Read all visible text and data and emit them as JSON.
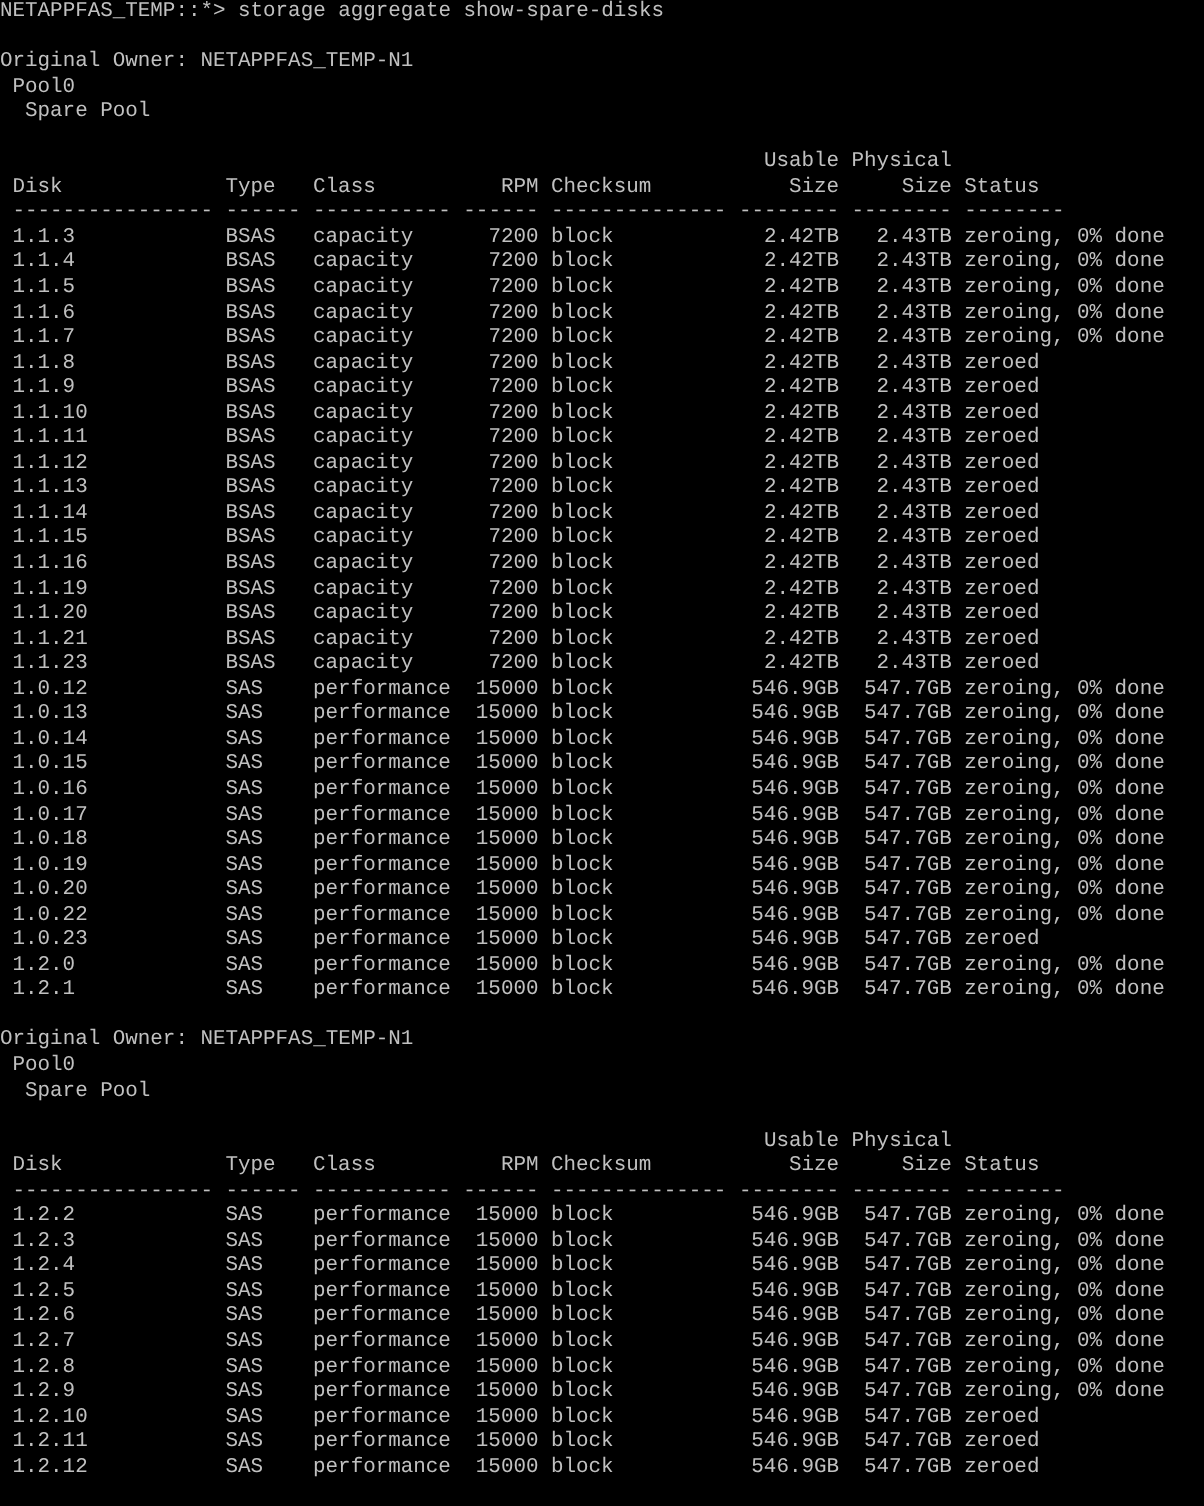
{
  "prompt": "NETAPPFAS_TEMP::*> storage aggregate show-spare-disks",
  "sections": [
    {
      "owner": "Original Owner: NETAPPFAS_TEMP-N1",
      "pool": "Pool0",
      "spare_pool": "Spare Pool",
      "columns": [
        {
          "label": "Disk"
        },
        {
          "label": "Type"
        },
        {
          "label": "Class"
        },
        {
          "label": "RPM"
        },
        {
          "label": "Checksum"
        },
        {
          "label_above": "Usable",
          "label": "Size"
        },
        {
          "label_above": "Physical",
          "label": "Size"
        },
        {
          "label": "Status"
        }
      ],
      "separators": [
        "----------------",
        "------",
        "-----------",
        "------",
        "--------------",
        "--------",
        "--------",
        "--------"
      ],
      "rows": [
        [
          "1.1.3",
          "BSAS",
          "capacity",
          "7200",
          "block",
          "2.42TB",
          "2.43TB",
          "zeroing, 0% done"
        ],
        [
          "1.1.4",
          "BSAS",
          "capacity",
          "7200",
          "block",
          "2.42TB",
          "2.43TB",
          "zeroing, 0% done"
        ],
        [
          "1.1.5",
          "BSAS",
          "capacity",
          "7200",
          "block",
          "2.42TB",
          "2.43TB",
          "zeroing, 0% done"
        ],
        [
          "1.1.6",
          "BSAS",
          "capacity",
          "7200",
          "block",
          "2.42TB",
          "2.43TB",
          "zeroing, 0% done"
        ],
        [
          "1.1.7",
          "BSAS",
          "capacity",
          "7200",
          "block",
          "2.42TB",
          "2.43TB",
          "zeroing, 0% done"
        ],
        [
          "1.1.8",
          "BSAS",
          "capacity",
          "7200",
          "block",
          "2.42TB",
          "2.43TB",
          "zeroed"
        ],
        [
          "1.1.9",
          "BSAS",
          "capacity",
          "7200",
          "block",
          "2.42TB",
          "2.43TB",
          "zeroed"
        ],
        [
          "1.1.10",
          "BSAS",
          "capacity",
          "7200",
          "block",
          "2.42TB",
          "2.43TB",
          "zeroed"
        ],
        [
          "1.1.11",
          "BSAS",
          "capacity",
          "7200",
          "block",
          "2.42TB",
          "2.43TB",
          "zeroed"
        ],
        [
          "1.1.12",
          "BSAS",
          "capacity",
          "7200",
          "block",
          "2.42TB",
          "2.43TB",
          "zeroed"
        ],
        [
          "1.1.13",
          "BSAS",
          "capacity",
          "7200",
          "block",
          "2.42TB",
          "2.43TB",
          "zeroed"
        ],
        [
          "1.1.14",
          "BSAS",
          "capacity",
          "7200",
          "block",
          "2.42TB",
          "2.43TB",
          "zeroed"
        ],
        [
          "1.1.15",
          "BSAS",
          "capacity",
          "7200",
          "block",
          "2.42TB",
          "2.43TB",
          "zeroed"
        ],
        [
          "1.1.16",
          "BSAS",
          "capacity",
          "7200",
          "block",
          "2.42TB",
          "2.43TB",
          "zeroed"
        ],
        [
          "1.1.19",
          "BSAS",
          "capacity",
          "7200",
          "block",
          "2.42TB",
          "2.43TB",
          "zeroed"
        ],
        [
          "1.1.20",
          "BSAS",
          "capacity",
          "7200",
          "block",
          "2.42TB",
          "2.43TB",
          "zeroed"
        ],
        [
          "1.1.21",
          "BSAS",
          "capacity",
          "7200",
          "block",
          "2.42TB",
          "2.43TB",
          "zeroed"
        ],
        [
          "1.1.23",
          "BSAS",
          "capacity",
          "7200",
          "block",
          "2.42TB",
          "2.43TB",
          "zeroed"
        ],
        [
          "1.0.12",
          "SAS",
          "performance",
          "15000",
          "block",
          "546.9GB",
          "547.7GB",
          "zeroing, 0% done"
        ],
        [
          "1.0.13",
          "SAS",
          "performance",
          "15000",
          "block",
          "546.9GB",
          "547.7GB",
          "zeroing, 0% done"
        ],
        [
          "1.0.14",
          "SAS",
          "performance",
          "15000",
          "block",
          "546.9GB",
          "547.7GB",
          "zeroing, 0% done"
        ],
        [
          "1.0.15",
          "SAS",
          "performance",
          "15000",
          "block",
          "546.9GB",
          "547.7GB",
          "zeroing, 0% done"
        ],
        [
          "1.0.16",
          "SAS",
          "performance",
          "15000",
          "block",
          "546.9GB",
          "547.7GB",
          "zeroing, 0% done"
        ],
        [
          "1.0.17",
          "SAS",
          "performance",
          "15000",
          "block",
          "546.9GB",
          "547.7GB",
          "zeroing, 0% done"
        ],
        [
          "1.0.18",
          "SAS",
          "performance",
          "15000",
          "block",
          "546.9GB",
          "547.7GB",
          "zeroing, 0% done"
        ],
        [
          "1.0.19",
          "SAS",
          "performance",
          "15000",
          "block",
          "546.9GB",
          "547.7GB",
          "zeroing, 0% done"
        ],
        [
          "1.0.20",
          "SAS",
          "performance",
          "15000",
          "block",
          "546.9GB",
          "547.7GB",
          "zeroing, 0% done"
        ],
        [
          "1.0.22",
          "SAS",
          "performance",
          "15000",
          "block",
          "546.9GB",
          "547.7GB",
          "zeroing, 0% done"
        ],
        [
          "1.0.23",
          "SAS",
          "performance",
          "15000",
          "block",
          "546.9GB",
          "547.7GB",
          "zeroed"
        ],
        [
          "1.2.0",
          "SAS",
          "performance",
          "15000",
          "block",
          "546.9GB",
          "547.7GB",
          "zeroing, 0% done"
        ],
        [
          "1.2.1",
          "SAS",
          "performance",
          "15000",
          "block",
          "546.9GB",
          "547.7GB",
          "zeroing, 0% done"
        ]
      ]
    },
    {
      "owner": "Original Owner: NETAPPFAS_TEMP-N1",
      "pool": "Pool0",
      "spare_pool": "Spare Pool",
      "columns": [
        {
          "label": "Disk"
        },
        {
          "label": "Type"
        },
        {
          "label": "Class"
        },
        {
          "label": "RPM"
        },
        {
          "label": "Checksum"
        },
        {
          "label_above": "Usable",
          "label": "Size"
        },
        {
          "label_above": "Physical",
          "label": "Size"
        },
        {
          "label": "Status"
        }
      ],
      "separators": [
        "----------------",
        "------",
        "-----------",
        "------",
        "--------------",
        "--------",
        "--------",
        "--------"
      ],
      "rows": [
        [
          "1.2.2",
          "SAS",
          "performance",
          "15000",
          "block",
          "546.9GB",
          "547.7GB",
          "zeroing, 0% done"
        ],
        [
          "1.2.3",
          "SAS",
          "performance",
          "15000",
          "block",
          "546.9GB",
          "547.7GB",
          "zeroing, 0% done"
        ],
        [
          "1.2.4",
          "SAS",
          "performance",
          "15000",
          "block",
          "546.9GB",
          "547.7GB",
          "zeroing, 0% done"
        ],
        [
          "1.2.5",
          "SAS",
          "performance",
          "15000",
          "block",
          "546.9GB",
          "547.7GB",
          "zeroing, 0% done"
        ],
        [
          "1.2.6",
          "SAS",
          "performance",
          "15000",
          "block",
          "546.9GB",
          "547.7GB",
          "zeroing, 0% done"
        ],
        [
          "1.2.7",
          "SAS",
          "performance",
          "15000",
          "block",
          "546.9GB",
          "547.7GB",
          "zeroing, 0% done"
        ],
        [
          "1.2.8",
          "SAS",
          "performance",
          "15000",
          "block",
          "546.9GB",
          "547.7GB",
          "zeroing, 0% done"
        ],
        [
          "1.2.9",
          "SAS",
          "performance",
          "15000",
          "block",
          "546.9GB",
          "547.7GB",
          "zeroing, 0% done"
        ],
        [
          "1.2.10",
          "SAS",
          "performance",
          "15000",
          "block",
          "546.9GB",
          "547.7GB",
          "zeroed"
        ],
        [
          "1.2.11",
          "SAS",
          "performance",
          "15000",
          "block",
          "546.9GB",
          "547.7GB",
          "zeroed"
        ],
        [
          "1.2.12",
          "SAS",
          "performance",
          "15000",
          "block",
          "546.9GB",
          "547.7GB",
          "zeroed"
        ]
      ]
    }
  ]
}
